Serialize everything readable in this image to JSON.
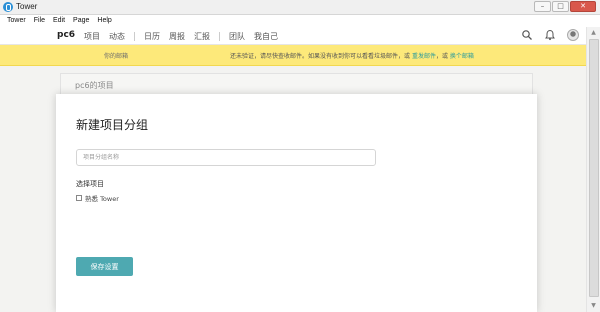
{
  "window": {
    "title": "Tower",
    "buttons": {
      "minimize": "–",
      "maximize": "□",
      "close": "✕"
    }
  },
  "menu": {
    "items": [
      "Tower",
      "File",
      "Edit",
      "Page",
      "Help"
    ]
  },
  "header": {
    "brand": "pc6",
    "nav": [
      "项目",
      "动态",
      "日历",
      "周报",
      "汇报",
      "团队",
      "我自己"
    ],
    "icons": [
      "search-icon",
      "bell-icon",
      "avatar"
    ]
  },
  "banner": {
    "email": "你的邮箱",
    "msg_before": "还未验证，请尽快查收邮件。如果没有收到你可以看看垃圾邮件，或",
    "resend_link": "重发邮件",
    "msg_middle": "，或",
    "change_link": "换个邮箱",
    "color": "#fde97a"
  },
  "project_card": {
    "title": "pc6的项目"
  },
  "modal": {
    "title": "新建项目分组",
    "name_placeholder": "项目分组名称",
    "name_value": "",
    "select_label": "选择项目",
    "projects": [
      {
        "label": "熟悉 Tower",
        "checked": false
      }
    ],
    "save_button": "保存设置",
    "accent_color": "#4ea9b1"
  },
  "scrollbar": {
    "up": "▲",
    "down": "▼"
  }
}
